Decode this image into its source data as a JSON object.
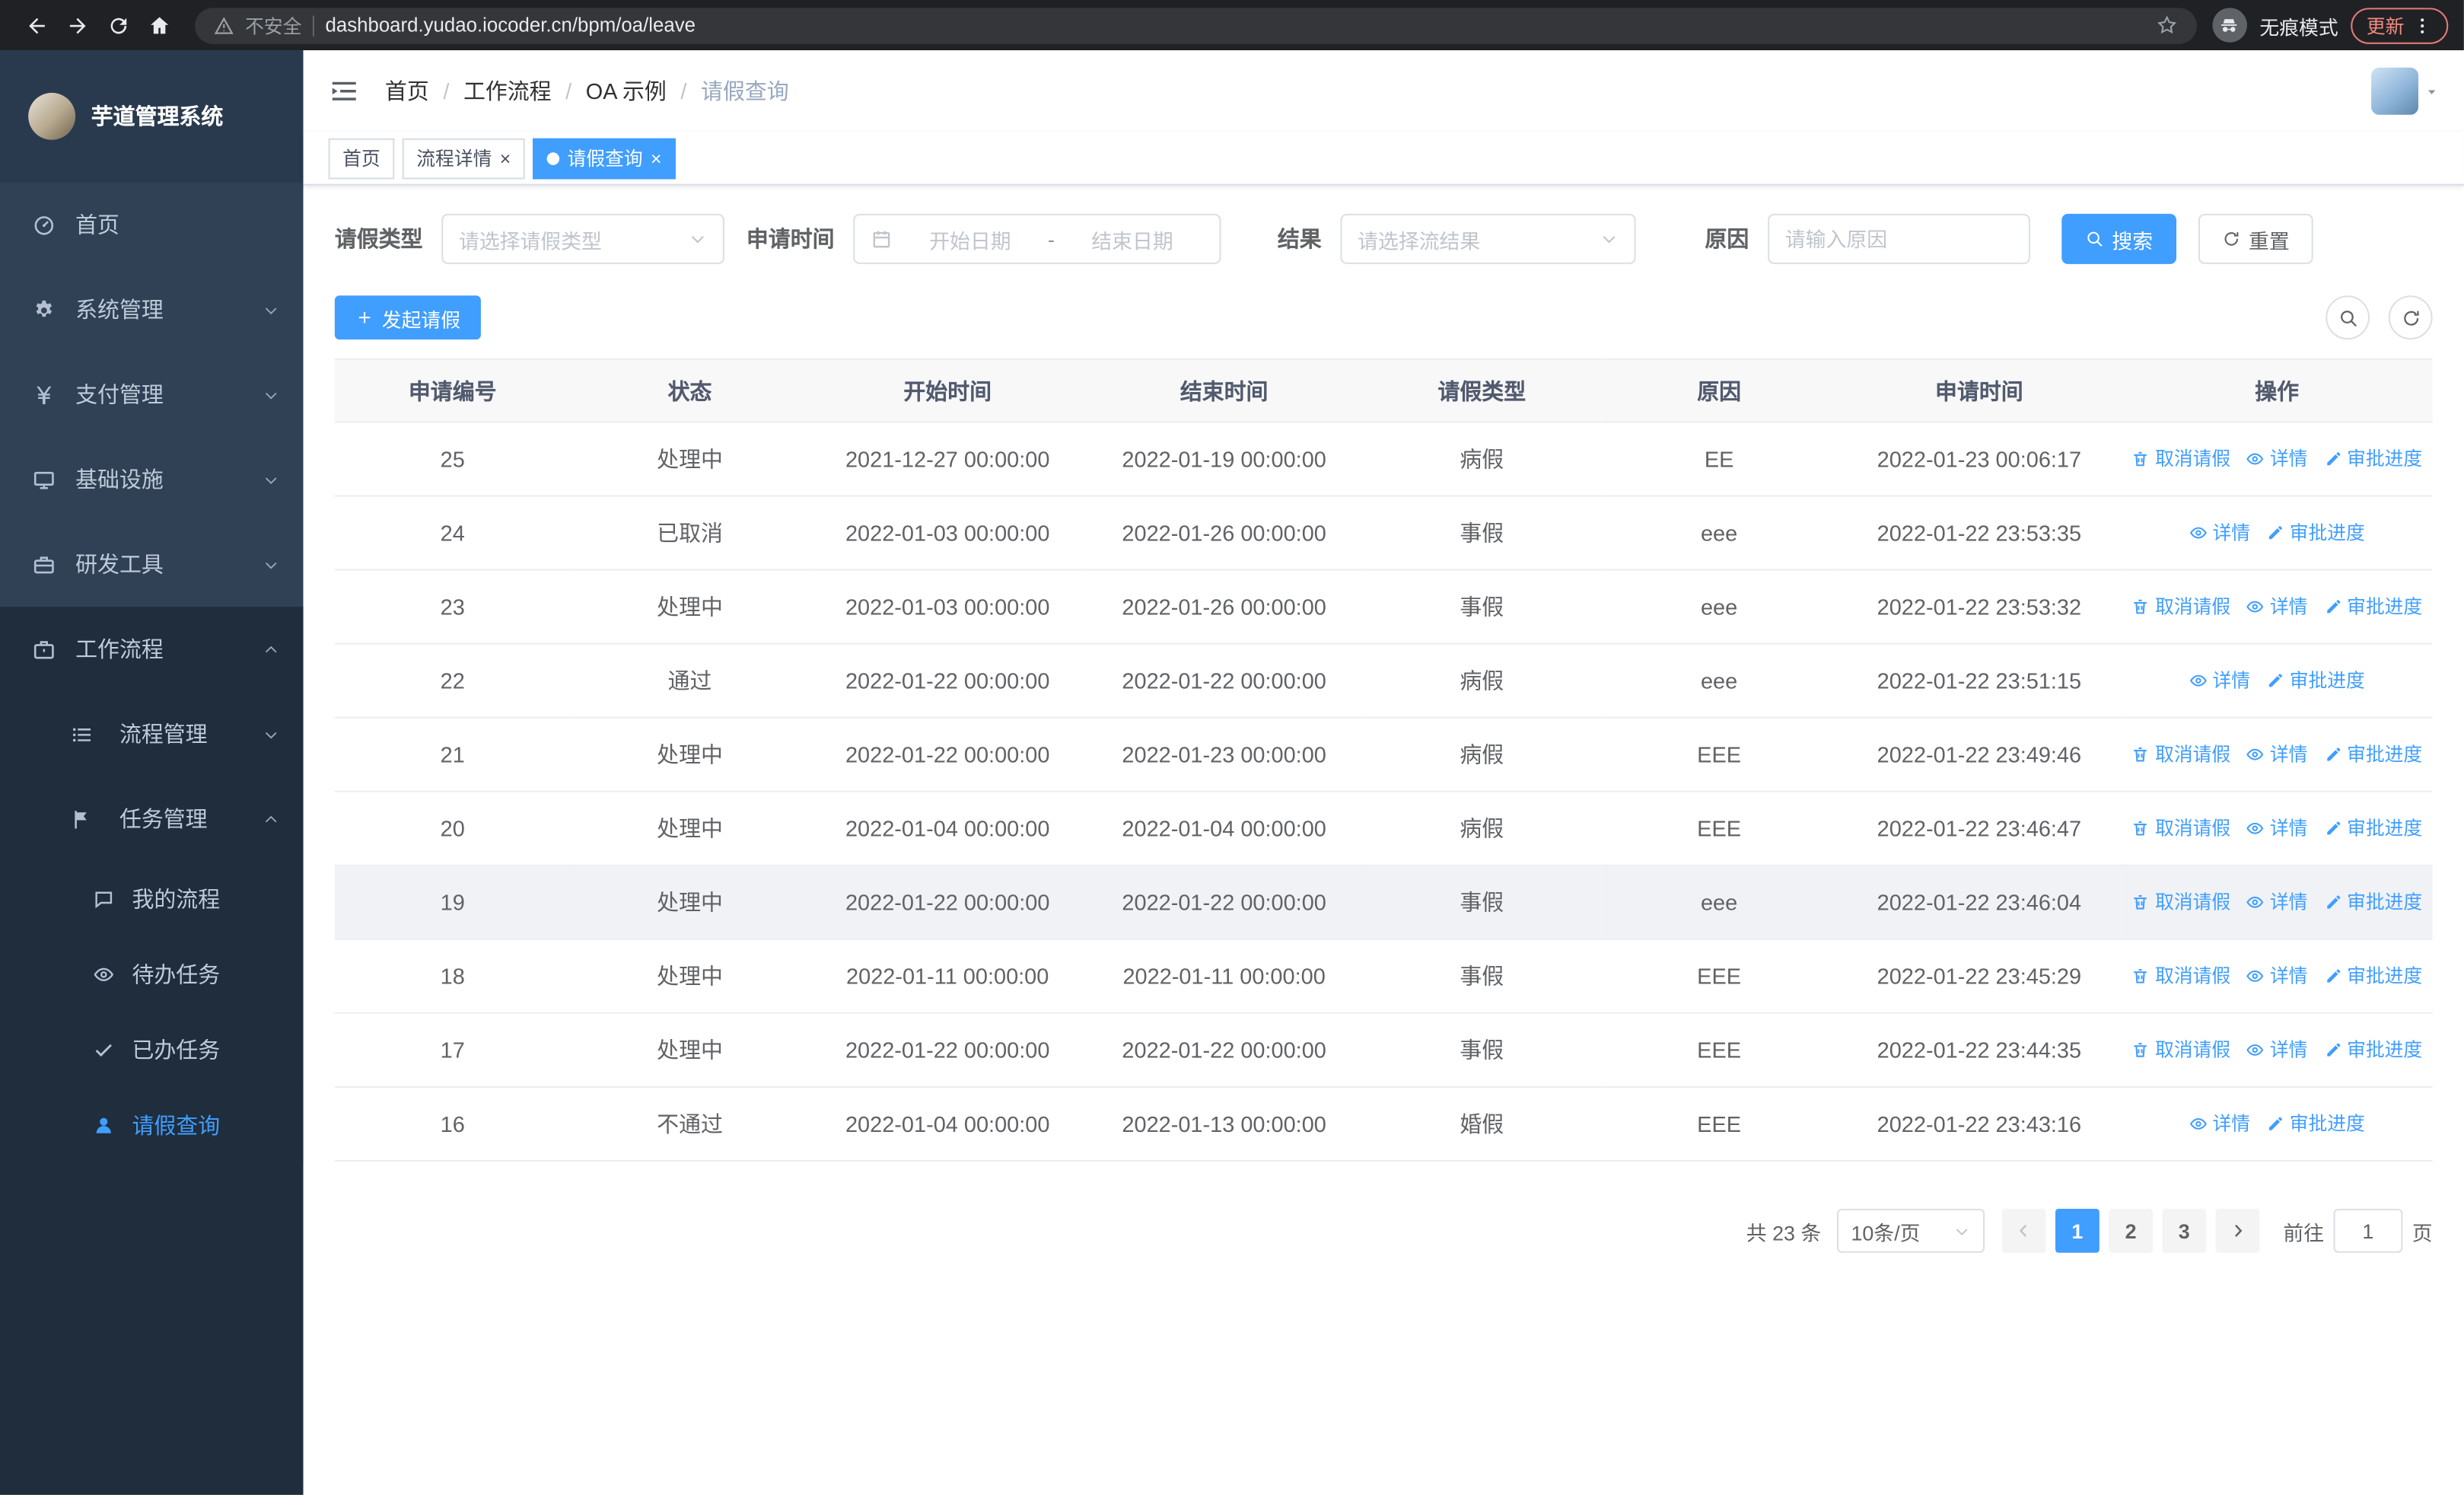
{
  "browser": {
    "security_warning": "不安全",
    "url": "dashboard.yudao.iocoder.cn/bpm/oa/leave",
    "incognito_label": "无痕模式",
    "update_label": "更新"
  },
  "sidebar": {
    "logo_title": "芋道管理系统",
    "items": [
      {
        "label": "首页",
        "icon": "dashboard-icon",
        "level": "top",
        "arrow": ""
      },
      {
        "label": "系统管理",
        "icon": "gear-icon",
        "level": "top",
        "arrow": "down"
      },
      {
        "label": "支付管理",
        "icon": "yen-icon",
        "level": "top",
        "arrow": "down"
      },
      {
        "label": "基础设施",
        "icon": "monitor-icon",
        "level": "top",
        "arrow": "down"
      },
      {
        "label": "研发工具",
        "icon": "toolbox-icon",
        "level": "top",
        "arrow": "down"
      },
      {
        "label": "工作流程",
        "icon": "briefcase-icon",
        "level": "top",
        "arrow": "up",
        "open": true
      },
      {
        "label": "流程管理",
        "icon": "list-icon",
        "level": "sub",
        "arrow": "down"
      },
      {
        "label": "任务管理",
        "icon": "flag-icon",
        "level": "sub",
        "arrow": "up"
      },
      {
        "label": "我的流程",
        "icon": "chat-icon",
        "level": "leaf",
        "arrow": ""
      },
      {
        "label": "待办任务",
        "icon": "eye-icon",
        "level": "leaf",
        "arrow": ""
      },
      {
        "label": "已办任务",
        "icon": "check-icon",
        "level": "leaf",
        "arrow": ""
      },
      {
        "label": "请假查询",
        "icon": "user-icon",
        "level": "leaf",
        "arrow": "",
        "active": true
      }
    ]
  },
  "header": {
    "breadcrumb": [
      "首页",
      "工作流程",
      "OA 示例",
      "请假查询"
    ],
    "icons": [
      "search-icon",
      "github-icon",
      "help-icon",
      "fullscreen-icon",
      "font-size-icon"
    ]
  },
  "tabs": [
    {
      "label": "首页",
      "closable": false,
      "active": false
    },
    {
      "label": "流程详情",
      "closable": true,
      "active": false
    },
    {
      "label": "请假查询",
      "closable": true,
      "active": true
    }
  ],
  "filters": {
    "leave_type_label": "请假类型",
    "leave_type_placeholder": "请选择请假类型",
    "apply_time_label": "申请时间",
    "start_date_placeholder": "开始日期",
    "range_separator": "-",
    "end_date_placeholder": "结束日期",
    "result_label": "结果",
    "result_placeholder": "请选择流结果",
    "reason_label": "原因",
    "reason_placeholder": "请输入原因",
    "search_label": "搜索",
    "reset_label": "重置"
  },
  "toolbar": {
    "create_label": "发起请假"
  },
  "table": {
    "columns": [
      "申请编号",
      "状态",
      "开始时间",
      "结束时间",
      "请假类型",
      "原因",
      "申请时间",
      "操作"
    ],
    "action_labels": {
      "cancel": "取消请假",
      "detail": "详情",
      "progress": "审批进度"
    },
    "rows": [
      {
        "id": "25",
        "status": "处理中",
        "start": "2021-12-27 00:00:00",
        "end": "2022-01-19 00:00:00",
        "type": "病假",
        "reason": "EE",
        "applied": "2022-01-23 00:06:17",
        "actions": [
          "cancel",
          "detail",
          "progress"
        ],
        "highlight": false
      },
      {
        "id": "24",
        "status": "已取消",
        "start": "2022-01-03 00:00:00",
        "end": "2022-01-26 00:00:00",
        "type": "事假",
        "reason": "eee",
        "applied": "2022-01-22 23:53:35",
        "actions": [
          "detail",
          "progress"
        ],
        "highlight": false
      },
      {
        "id": "23",
        "status": "处理中",
        "start": "2022-01-03 00:00:00",
        "end": "2022-01-26 00:00:00",
        "type": "事假",
        "reason": "eee",
        "applied": "2022-01-22 23:53:32",
        "actions": [
          "cancel",
          "detail",
          "progress"
        ],
        "highlight": false
      },
      {
        "id": "22",
        "status": "通过",
        "start": "2022-01-22 00:00:00",
        "end": "2022-01-22 00:00:00",
        "type": "病假",
        "reason": "eee",
        "applied": "2022-01-22 23:51:15",
        "actions": [
          "detail",
          "progress"
        ],
        "highlight": false
      },
      {
        "id": "21",
        "status": "处理中",
        "start": "2022-01-22 00:00:00",
        "end": "2022-01-23 00:00:00",
        "type": "病假",
        "reason": "EEE",
        "applied": "2022-01-22 23:49:46",
        "actions": [
          "cancel",
          "detail",
          "progress"
        ],
        "highlight": false
      },
      {
        "id": "20",
        "status": "处理中",
        "start": "2022-01-04 00:00:00",
        "end": "2022-01-04 00:00:00",
        "type": "病假",
        "reason": "EEE",
        "applied": "2022-01-22 23:46:47",
        "actions": [
          "cancel",
          "detail",
          "progress"
        ],
        "highlight": false
      },
      {
        "id": "19",
        "status": "处理中",
        "start": "2022-01-22 00:00:00",
        "end": "2022-01-22 00:00:00",
        "type": "事假",
        "reason": "eee",
        "applied": "2022-01-22 23:46:04",
        "actions": [
          "cancel",
          "detail",
          "progress"
        ],
        "highlight": true
      },
      {
        "id": "18",
        "status": "处理中",
        "start": "2022-01-11 00:00:00",
        "end": "2022-01-11 00:00:00",
        "type": "事假",
        "reason": "EEE",
        "applied": "2022-01-22 23:45:29",
        "actions": [
          "cancel",
          "detail",
          "progress"
        ],
        "highlight": false
      },
      {
        "id": "17",
        "status": "处理中",
        "start": "2022-01-22 00:00:00",
        "end": "2022-01-22 00:00:00",
        "type": "事假",
        "reason": "EEE",
        "applied": "2022-01-22 23:44:35",
        "actions": [
          "cancel",
          "detail",
          "progress"
        ],
        "highlight": false
      },
      {
        "id": "16",
        "status": "不通过",
        "start": "2022-01-04 00:00:00",
        "end": "2022-01-13 00:00:00",
        "type": "婚假",
        "reason": "EEE",
        "applied": "2022-01-22 23:43:16",
        "actions": [
          "detail",
          "progress"
        ],
        "highlight": false
      }
    ]
  },
  "pagination": {
    "total_text": "共 23 条",
    "page_size": "10条/页",
    "pages": [
      "1",
      "2",
      "3"
    ],
    "current": "1",
    "goto_label": "前往",
    "goto_value": "1",
    "goto_suffix": "页"
  },
  "colors": {
    "accent": "#409eff",
    "sidebar_bg": "#304156",
    "submenu_bg": "#1f2d3d",
    "chrome_bg": "#202124"
  }
}
